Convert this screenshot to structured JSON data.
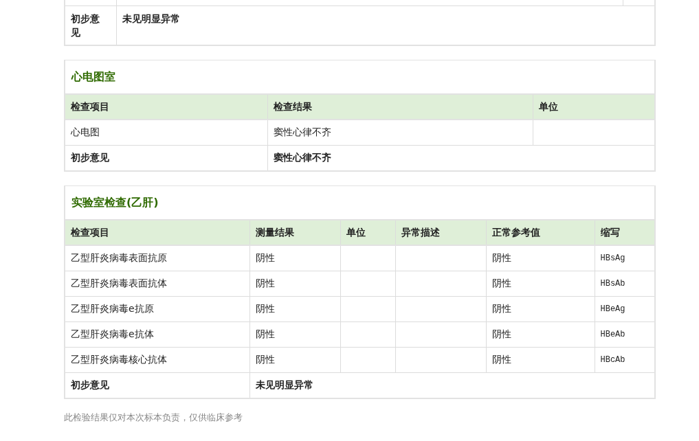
{
  "sections": [
    {
      "kind": "cut",
      "conclusion": {
        "label": "初步意见",
        "text": "未见明显异常"
      }
    },
    {
      "kind": "table",
      "title": "心电图室",
      "columns": [
        {
          "label": "检查项目",
          "kind": "text"
        },
        {
          "label": "检查结果",
          "kind": "text"
        },
        {
          "label": "单位",
          "kind": "text"
        }
      ],
      "rows": [
        [
          "心电图",
          "窦性心律不齐",
          null
        ]
      ],
      "conclusion": {
        "label": "初步意见",
        "text": "窦性心律不齐"
      }
    },
    {
      "kind": "table",
      "title": "实验室检查(乙肝)",
      "columns": [
        {
          "label": "检查项目",
          "kind": "text"
        },
        {
          "label": "测量结果",
          "kind": "text"
        },
        {
          "label": "单位",
          "kind": "text"
        },
        {
          "label": "异常描述",
          "kind": "text"
        },
        {
          "label": "正常参考值",
          "kind": "text"
        },
        {
          "label": "缩写",
          "kind": "code"
        }
      ],
      "rows": [
        [
          "乙型肝炎病毒表面抗原",
          "阴性",
          null,
          null,
          "阴性",
          "HBsAg"
        ],
        [
          "乙型肝炎病毒表面抗体",
          "阴性",
          null,
          null,
          "阴性",
          "HBsAb"
        ],
        [
          "乙型肝炎病毒e抗原",
          "阴性",
          null,
          null,
          "阴性",
          "HBeAg"
        ],
        [
          "乙型肝炎病毒e抗体",
          "阴性",
          null,
          null,
          "阴性",
          "HBeAb"
        ],
        [
          "乙型肝炎病毒核心抗体",
          "阴性",
          null,
          null,
          "阴性",
          "HBcAb"
        ]
      ],
      "conclusion": {
        "label": "初步意见",
        "text": "未见明显异常"
      }
    }
  ],
  "footer": "此检验结果仅对本次标本负责，仅供临床参考"
}
